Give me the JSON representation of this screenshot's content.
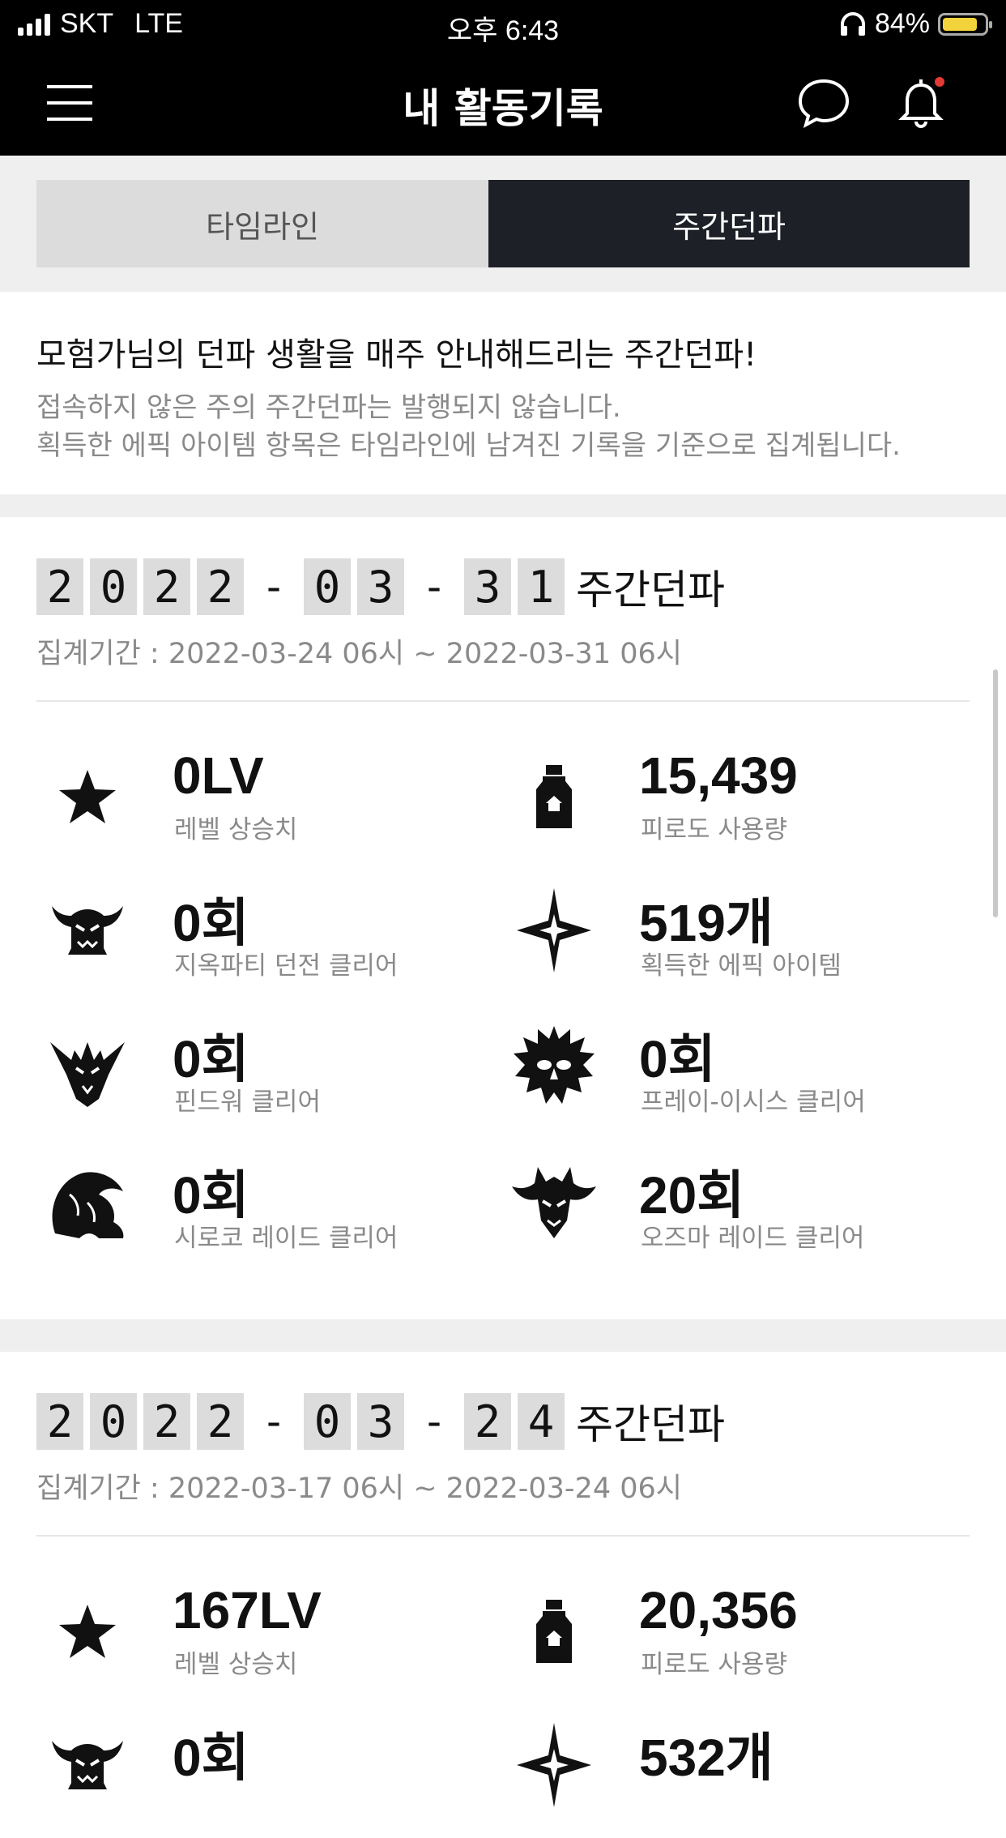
{
  "status_bar": {
    "carrier": "SKT",
    "network": "LTE",
    "time": "오후 6:43",
    "battery_percent": "84%",
    "battery_level": 0.84
  },
  "header": {
    "title": "내 활동기록",
    "icons": [
      "menu-icon",
      "chat-icon",
      "bell-icon"
    ]
  },
  "tabs": [
    {
      "label": "타임라인",
      "active": false
    },
    {
      "label": "주간던파",
      "active": true
    }
  ],
  "intro": {
    "title": "모험가님의 던파 생활을 매주 안내해드리는 주간던파!",
    "line1": "접속하지 않은 주의 주간던파는 발행되지 않습니다.",
    "line2": "획득한 에픽 아이템 항목은 타임라인에 남겨진 기록을 기준으로 집계됩니다."
  },
  "weeks": [
    {
      "date_digits": [
        "2",
        "0",
        "2",
        "2",
        "-",
        "0",
        "3",
        "-",
        "3",
        "1"
      ],
      "suffix": "주간던파",
      "period": "집계기간 : 2022-03-24 06시 ~ 2022-03-31 06시",
      "stats": [
        {
          "value": "0LV",
          "label": "레벨 상승치",
          "icon": "star-icon"
        },
        {
          "value": "15,439",
          "label": "피로도 사용량",
          "icon": "potion-bottle-icon"
        },
        {
          "value": "0회",
          "label": "지옥파티 던전 클리어",
          "icon": "demon-horns-icon"
        },
        {
          "value": "519개",
          "label": "획득한 에픽 아이템",
          "icon": "sparkle-star-icon"
        },
        {
          "value": "0회",
          "label": "핀드워 클리어",
          "icon": "dragon-skull-icon"
        },
        {
          "value": "0회",
          "label": "프레이-이시스 클리어",
          "icon": "owl-beast-icon"
        },
        {
          "value": "0회",
          "label": "시로코 레이드 클리어",
          "icon": "siroco-head-icon"
        },
        {
          "value": "20회",
          "label": "오즈마 레이드 클리어",
          "icon": "ozma-mask-icon"
        }
      ]
    },
    {
      "date_digits": [
        "2",
        "0",
        "2",
        "2",
        "-",
        "0",
        "3",
        "-",
        "2",
        "4"
      ],
      "suffix": "주간던파",
      "period": "집계기간 : 2022-03-17 06시 ~ 2022-03-24 06시",
      "stats": [
        {
          "value": "167LV",
          "label": "레벨 상승치",
          "icon": "star-icon"
        },
        {
          "value": "20,356",
          "label": "피로도 사용량",
          "icon": "potion-bottle-icon"
        },
        {
          "value": "0회",
          "label": "",
          "icon": "demon-horns-icon"
        },
        {
          "value": "532개",
          "label": "",
          "icon": "sparkle-star-icon"
        }
      ]
    }
  ]
}
